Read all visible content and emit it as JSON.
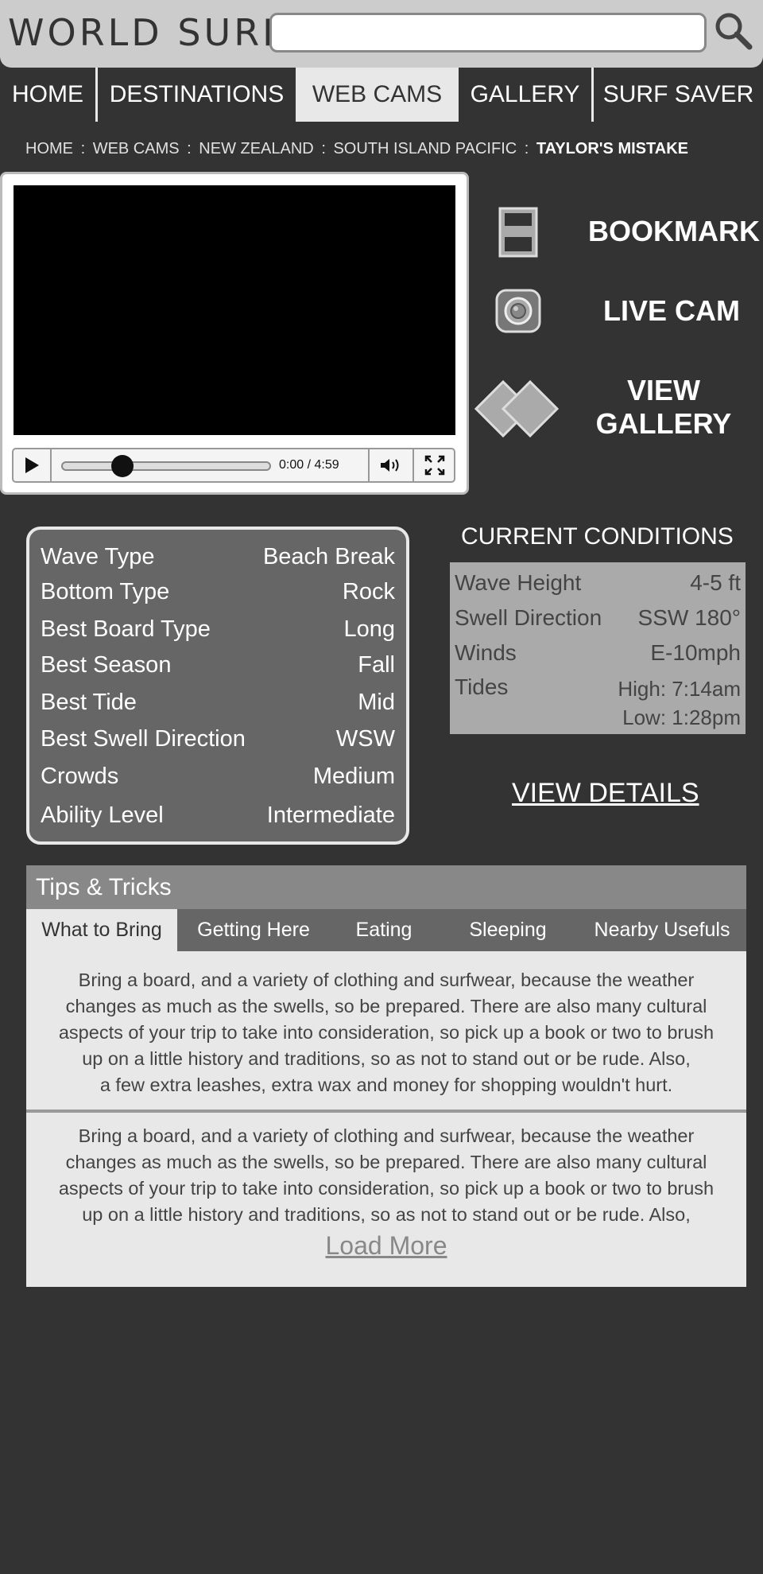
{
  "header": {
    "logo": "WORLD SURF",
    "search_placeholder": "",
    "search_icon": "search-icon"
  },
  "nav": {
    "items": [
      {
        "label": "HOME",
        "active": false
      },
      {
        "label": "DESTINATIONS",
        "active": false
      },
      {
        "label": "WEB CAMS",
        "active": true
      },
      {
        "label": "GALLERY",
        "active": false
      },
      {
        "label": "SURF SAVER",
        "active": false
      }
    ]
  },
  "breadcrumb": {
    "items": [
      "HOME",
      "WEB CAMS",
      "NEW ZEALAND",
      "SOUTH ISLAND PACIFIC"
    ],
    "separator": ":",
    "current": "TAYLOR'S MISTAKE"
  },
  "player": {
    "time": "0:00 / 4:59",
    "progress_fraction": 0.29,
    "icons": {
      "play": "play-icon",
      "volume": "volume-icon",
      "fullscreen": "fullscreen-icon"
    }
  },
  "actions": {
    "bookmark": "BOOKMARK",
    "live_cam": "LIVE CAM",
    "view_gallery_line1": "VIEW",
    "view_gallery_line2": "GALLERY"
  },
  "surf_info": {
    "rows": [
      {
        "label": "Wave Type",
        "value": "Beach Break"
      },
      {
        "label": "Bottom Type",
        "value": "Rock"
      },
      {
        "label": "Best Board Type",
        "value": "Long"
      },
      {
        "label": "Best Season",
        "value": "Fall"
      },
      {
        "label": "Best Tide",
        "value": "Mid"
      },
      {
        "label": "Best Swell Direction",
        "value": "WSW"
      },
      {
        "label": "Crowds",
        "value": "Medium"
      },
      {
        "label": "Ability Level",
        "value": "Intermediate"
      }
    ]
  },
  "conditions": {
    "title": "CURRENT CONDITIONS",
    "wave_height_label": "Wave Height",
    "wave_height_value": "4-5 ft",
    "swell_direction_label": "Swell Direction",
    "swell_direction_value": "SSW 180°",
    "winds_label": "Winds",
    "winds_value": "E-10mph",
    "tides_label": "Tides",
    "tides_high": "High: 7:14am",
    "tides_low": "Low: 1:28pm",
    "view_details": "VIEW DETAILS"
  },
  "tips": {
    "title": "Tips & Tricks",
    "tabs": [
      {
        "label": "What to Bring",
        "active": true
      },
      {
        "label": "Getting Here",
        "active": false
      },
      {
        "label": "Eating",
        "active": false
      },
      {
        "label": "Sleeping",
        "active": false
      },
      {
        "label": "Nearby Usefuls",
        "active": false
      }
    ],
    "paragraph1": [
      "Bring a board, and a variety of clothing and surfwear, because the weather",
      "changes as much as the swells, so be prepared. There are also many cultural",
      "aspects of your trip to take into consideration, so pick up a book or two to brush",
      "up on a little history and traditions, so as not to stand out or be rude. Also,",
      "a few extra leashes, extra wax and money for shopping wouldn't hurt."
    ],
    "paragraph2": [
      "Bring a board, and a variety of clothing and surfwear, because the weather",
      "changes as much as the swells, so be prepared. There are also many cultural",
      "aspects of your trip to take into consideration, so pick up a book or two to brush",
      "up on a little history and traditions, so as not to stand out or be rude. Also,"
    ],
    "load_more": "Load More"
  }
}
